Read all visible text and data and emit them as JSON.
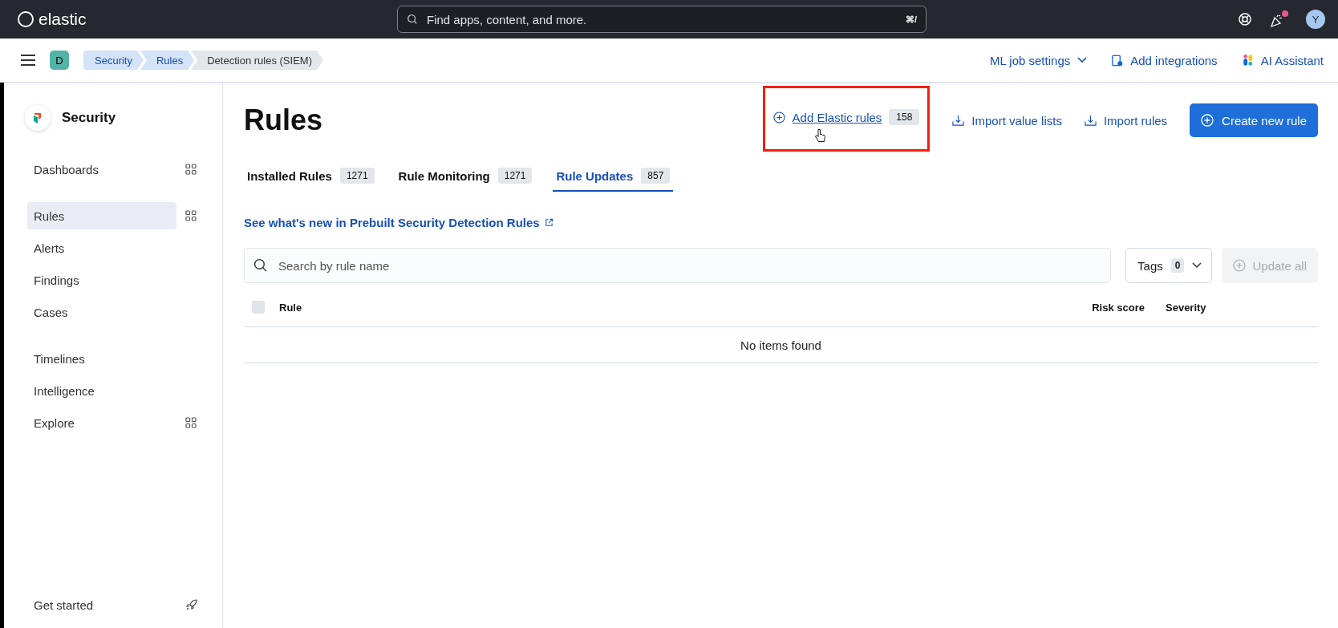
{
  "top_bar": {
    "logo": "elastic",
    "search": {
      "placeholder": "Find apps, content, and more.",
      "shortcut": "⌘/"
    },
    "notification": true,
    "avatar": "Y"
  },
  "nav_bar": {
    "space": "D",
    "breadcrumbs": [
      {
        "label": "Security",
        "selected": false
      },
      {
        "label": "Rules",
        "selected": false
      },
      {
        "label": "Detection rules (SIEM)",
        "selected": true
      }
    ],
    "links": [
      {
        "label": "ML job settings",
        "kind": "dropdown"
      },
      {
        "label": "Add integrations",
        "kind": "integrations"
      },
      {
        "label": "AI Assistant",
        "kind": "assistant"
      }
    ]
  },
  "sidebar": {
    "title": "Security",
    "sections": [
      [
        {
          "label": "Dashboards",
          "selected": false,
          "panel": true
        }
      ],
      [
        {
          "label": "Rules",
          "selected": true,
          "panel": true
        },
        {
          "label": "Alerts",
          "selected": false,
          "panel": false
        },
        {
          "label": "Findings",
          "selected": false,
          "panel": false
        },
        {
          "label": "Cases",
          "selected": false,
          "panel": false
        }
      ],
      [
        {
          "label": "Timelines",
          "selected": false,
          "panel": false
        },
        {
          "label": "Intelligence",
          "selected": false,
          "panel": false
        },
        {
          "label": "Explore",
          "selected": false,
          "panel": true
        }
      ]
    ],
    "footer": "Get started"
  },
  "page": {
    "title": "Rules",
    "actions": [
      {
        "label": "Add Elastic rules",
        "badge": "158",
        "kind": "add",
        "highlighted": true,
        "hovered": true
      },
      {
        "label": "Import value lists",
        "kind": "import",
        "highlighted": false,
        "hovered": false
      },
      {
        "label": "Import rules",
        "kind": "import",
        "highlighted": false,
        "hovered": false
      },
      {
        "label": "Create new rule",
        "kind": "primary",
        "highlighted": false,
        "hovered": false
      }
    ],
    "tabs": [
      {
        "label": "Installed Rules",
        "count": "1271",
        "selected": false
      },
      {
        "label": "Rule Monitoring",
        "count": "1271",
        "selected": false
      },
      {
        "label": "Rule Updates",
        "count": "857",
        "selected": true
      }
    ],
    "link": "See what's new in Prebuilt Security Detection Rules",
    "search": {
      "placeholder": "Search by rule name"
    },
    "tags": {
      "label": "Tags",
      "count": "0"
    },
    "update_all": {
      "label": "Update all",
      "disabled": true
    },
    "table": {
      "select_all_checked": false,
      "columns": [
        "Rule",
        "Risk score",
        "Severity"
      ],
      "empty": "No items found"
    }
  }
}
